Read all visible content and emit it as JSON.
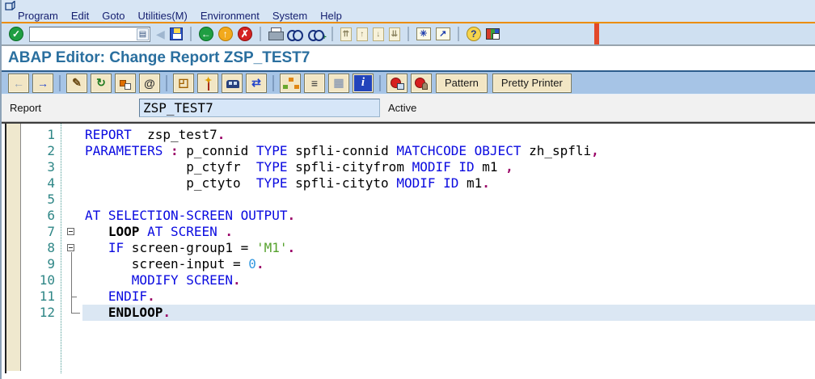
{
  "header": {
    "title": "ABAP Editor: Change Report ZSP_TEST7"
  },
  "menu": {
    "items": [
      "Program",
      "Edit",
      "Goto",
      "Utilities(M)",
      "Environment",
      "System",
      "Help"
    ]
  },
  "standard_toolbar": {
    "command_field_value": "",
    "items": [
      {
        "name": "enter-icon",
        "type": "circle-green",
        "glyph": "✓"
      },
      {
        "name": "command-input",
        "type": "input"
      },
      {
        "name": "collapse-icon",
        "type": "collapse",
        "glyph": "◀"
      },
      {
        "name": "save-icon",
        "type": "floppy"
      },
      {
        "type": "sep"
      },
      {
        "name": "back-icon",
        "type": "circle-green",
        "glyph": "←"
      },
      {
        "name": "exit-icon",
        "type": "circle-orange",
        "glyph": "↑"
      },
      {
        "name": "cancel-icon",
        "type": "circle-red",
        "glyph": "✗"
      },
      {
        "type": "sep"
      },
      {
        "name": "print-icon",
        "type": "printer"
      },
      {
        "name": "find-icon",
        "type": "binoculars"
      },
      {
        "name": "find-next-icon",
        "type": "binoculars-plus"
      },
      {
        "type": "sep"
      },
      {
        "name": "first-page-icon",
        "type": "page",
        "glyph": "⇈"
      },
      {
        "name": "previous-page-icon",
        "type": "page",
        "glyph": "↑"
      },
      {
        "name": "next-page-icon",
        "type": "page",
        "glyph": "↓"
      },
      {
        "name": "last-page-icon",
        "type": "page",
        "glyph": "⇊"
      },
      {
        "type": "sep"
      },
      {
        "name": "new-session-icon",
        "type": "tile",
        "glyph": "✳"
      },
      {
        "name": "create-shortcut-icon",
        "type": "tile",
        "glyph": "↗"
      },
      {
        "type": "sep"
      },
      {
        "name": "help-icon",
        "type": "circle-help",
        "glyph": "?"
      },
      {
        "name": "customize-layout-icon",
        "type": "screen"
      }
    ]
  },
  "app_toolbar": {
    "items": [
      {
        "name": "back-button",
        "type": "btn",
        "glyph": "←",
        "disabled": true
      },
      {
        "name": "forward-button",
        "type": "btn",
        "glyph": "→",
        "color": "#2244cc"
      },
      {
        "type": "sep"
      },
      {
        "name": "display-change-button",
        "type": "btn",
        "glyph": "✎",
        "color": "#6b4a14"
      },
      {
        "name": "check-button",
        "type": "btn",
        "glyph": "↻",
        "color": "#1f7a1f"
      },
      {
        "name": "activate-button",
        "type": "btn-activate"
      },
      {
        "name": "test-button",
        "type": "btn",
        "glyph": "@",
        "color": "#333333"
      },
      {
        "type": "sep"
      },
      {
        "name": "where-used-button",
        "type": "btn",
        "glyph": "◰",
        "color": "#a06000"
      },
      {
        "name": "wand-button",
        "type": "btn-wand"
      },
      {
        "name": "train-button",
        "type": "btn-train"
      },
      {
        "name": "navigate-button",
        "type": "btn",
        "glyph": "⇄",
        "color": "#2244cc"
      },
      {
        "type": "sep"
      },
      {
        "name": "object-list-button",
        "type": "btn-hierarchy"
      },
      {
        "name": "navigation-stack-button",
        "type": "btn",
        "glyph": "≡",
        "color": "#333333"
      },
      {
        "name": "table-button",
        "type": "btn",
        "glyph": "▦",
        "color": "#cabf96",
        "disabled": true
      },
      {
        "name": "info-button",
        "type": "btn-info",
        "glyph": "i"
      },
      {
        "type": "sep"
      },
      {
        "name": "breakpoint-button",
        "type": "btn-stop1"
      },
      {
        "name": "external-breakpoint-button",
        "type": "btn-stop2"
      },
      {
        "name": "pattern-button",
        "type": "btn-text",
        "label": "Pattern"
      },
      {
        "name": "pretty-printer-button",
        "type": "btn-text",
        "label": "Pretty Printer"
      }
    ]
  },
  "report_row": {
    "label": "Report",
    "value": "ZSP_TEST7",
    "status": "Active"
  },
  "editor": {
    "colors": {
      "kw": "#0a0ae0",
      "id": "#000000",
      "str": "#55a12c",
      "num": "#3399e0",
      "p": "#990066",
      "b": "#000000"
    },
    "line_numbers_color": "#2e8686",
    "folds": {
      "boxes": [
        7,
        8
      ],
      "bracket_from": 8,
      "bracket_to": 12,
      "tick_line": 11
    },
    "lines": [
      {
        "n": 1,
        "tokens": [
          [
            "kw",
            "REPORT"
          ],
          [
            "id",
            "  zsp_test7"
          ],
          [
            "p",
            "."
          ]
        ]
      },
      {
        "n": 2,
        "tokens": [
          [
            "kw",
            "PARAMETERS"
          ],
          [
            "id",
            " "
          ],
          [
            "p",
            ":"
          ],
          [
            "id",
            " p_connid "
          ],
          [
            "kw",
            "TYPE"
          ],
          [
            "id",
            " spfli-connid "
          ],
          [
            "kw",
            "MATCHCODE OBJECT"
          ],
          [
            "id",
            " zh_spfli"
          ],
          [
            "p",
            ","
          ]
        ]
      },
      {
        "n": 3,
        "tokens": [
          [
            "id",
            "             p_ctyfr  "
          ],
          [
            "kw",
            "TYPE"
          ],
          [
            "id",
            " spfli-cityfrom "
          ],
          [
            "kw",
            "MODIF ID"
          ],
          [
            "id",
            " m1 "
          ],
          [
            "p",
            ","
          ]
        ]
      },
      {
        "n": 4,
        "tokens": [
          [
            "id",
            "             p_ctyto  "
          ],
          [
            "kw",
            "TYPE"
          ],
          [
            "id",
            " spfli-cityto "
          ],
          [
            "kw",
            "MODIF ID"
          ],
          [
            "id",
            " m1"
          ],
          [
            "p",
            "."
          ]
        ]
      },
      {
        "n": 5,
        "tokens": []
      },
      {
        "n": 6,
        "tokens": [
          [
            "kw",
            "AT SELECTION-SCREEN OUTPUT"
          ],
          [
            "p",
            "."
          ]
        ]
      },
      {
        "n": 7,
        "tokens": [
          [
            "b",
            "   LOOP"
          ],
          [
            "kw",
            " AT SCREEN "
          ],
          [
            "p",
            "."
          ]
        ]
      },
      {
        "n": 8,
        "tokens": [
          [
            "kw",
            "   IF"
          ],
          [
            "id",
            " screen-group1 = "
          ],
          [
            "str",
            "'M1'"
          ],
          [
            "p",
            "."
          ]
        ]
      },
      {
        "n": 9,
        "tokens": [
          [
            "id",
            "      screen-input = "
          ],
          [
            "num",
            "0"
          ],
          [
            "p",
            "."
          ]
        ]
      },
      {
        "n": 10,
        "tokens": [
          [
            "kw",
            "      MODIFY SCREEN"
          ],
          [
            "p",
            "."
          ]
        ]
      },
      {
        "n": 11,
        "tokens": [
          [
            "kw",
            "   ENDIF"
          ],
          [
            "p",
            "."
          ]
        ]
      },
      {
        "n": 12,
        "highlight": true,
        "tokens": [
          [
            "b",
            "   ENDLOOP"
          ],
          [
            "p",
            "."
          ]
        ]
      }
    ]
  }
}
